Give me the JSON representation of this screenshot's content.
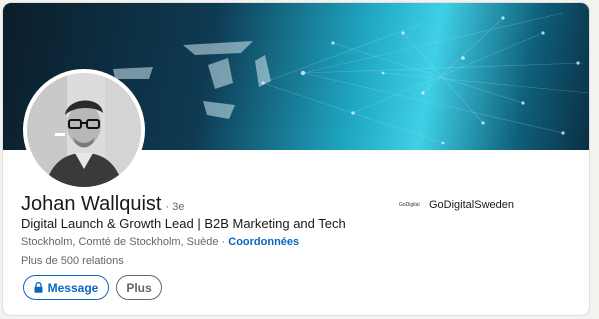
{
  "profile": {
    "name": "Johan Wallquist",
    "degree": "· 3e",
    "headline": "Digital Launch & Growth Lead | B2B Marketing and Tech",
    "location": "Stockholm, Comté de Stockholm, Suède",
    "location_separator": " · ",
    "contact_link": "Coordonnées",
    "connections": "Plus de 500 relations"
  },
  "actions": {
    "message_label": "Message",
    "more_label": "Plus"
  },
  "company": {
    "logo_text": "GoDigital",
    "name": "GoDigitalSweden"
  },
  "colors": {
    "accent": "#0a66c2",
    "text_primary": "#191919",
    "text_secondary": "#666666"
  },
  "icons": {
    "message_button_icon": "lock-icon"
  }
}
